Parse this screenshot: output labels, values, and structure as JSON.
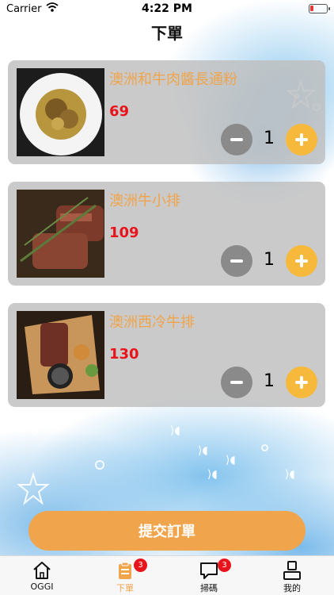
{
  "status_bar": {
    "carrier": "Carrier",
    "time": "4:22 PM"
  },
  "nav": {
    "title": "下單"
  },
  "order_items": [
    {
      "name": "澳洲和牛肉醬長通粉",
      "price": "69",
      "quantity": "1"
    },
    {
      "name": "澳洲牛小排",
      "price": "109",
      "quantity": "1"
    },
    {
      "name": "澳洲西冷牛排",
      "price": "130",
      "quantity": "1"
    }
  ],
  "submit": {
    "label": "提交訂單"
  },
  "tabbar": {
    "tabs": [
      {
        "label": "OGGI",
        "icon": "home-icon"
      },
      {
        "label": "下單",
        "icon": "order-icon",
        "badge": "3"
      },
      {
        "label": "掃碼",
        "icon": "chat-icon",
        "badge": "3"
      },
      {
        "label": "我的",
        "icon": "profile-icon"
      }
    ]
  },
  "colors": {
    "accent": "#f0a44c",
    "price": "#e8141c",
    "plus_button": "#f6b93b",
    "minus_button": "#8a8a8a",
    "card": "#bebebe"
  }
}
